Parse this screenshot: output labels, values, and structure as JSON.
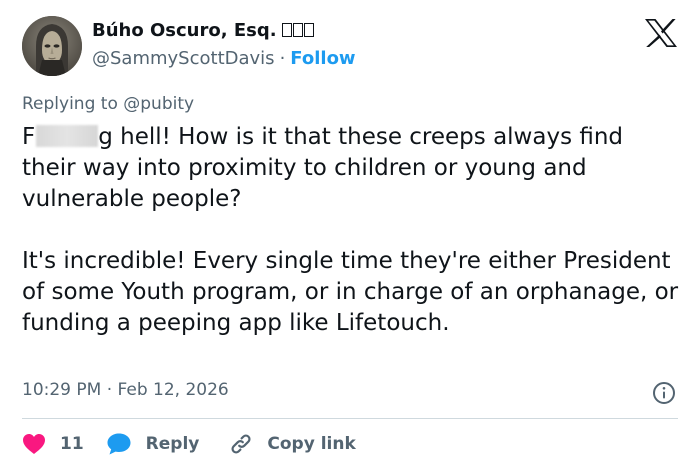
{
  "author": {
    "display_name": "Búho Oscuro, Esq.",
    "handle": "@SammyScottDavis",
    "follow_label": "Follow",
    "separator": "·"
  },
  "reply_context": {
    "prefix": "Replying to",
    "handle": "@pubity"
  },
  "tweet": {
    "p1_start": "F",
    "p1_rest": "g hell! How is it that these creeps always find their way into proximity to children or young and vulnerable people?",
    "p2": "It's incredible! Every single time they're either President of some Youth program, or in charge of an orphanage, or funding a peeping app like Lifetouch.",
    "timestamp": "10:29 PM · Feb 12, 2026"
  },
  "actions": {
    "likes": "11",
    "reply_label": "Reply",
    "copy_link_label": "Copy link"
  },
  "colors": {
    "like": "#f91880",
    "accent": "#1d9bf0",
    "secondary": "#536471",
    "text": "#0f1419"
  },
  "icons": [
    "x-logo-icon",
    "info-icon",
    "heart-icon",
    "speech-bubble-icon",
    "link-icon"
  ]
}
